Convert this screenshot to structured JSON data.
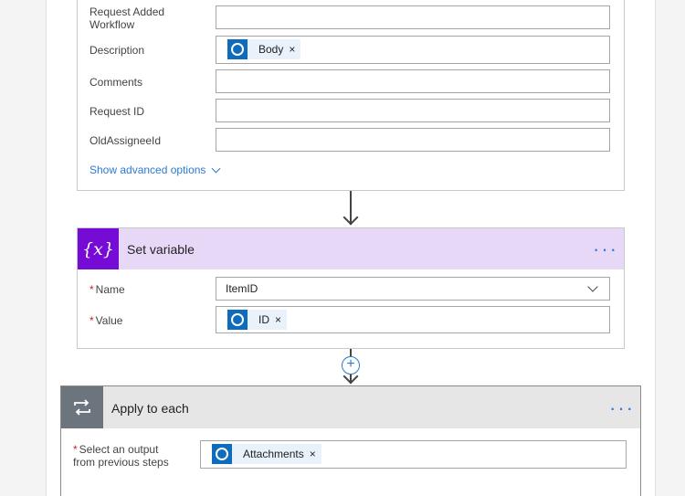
{
  "card1": {
    "fields": [
      {
        "label_line1": "Request Added",
        "label_line2": "Workflow",
        "value": ""
      },
      {
        "label": "Description",
        "token": "Body"
      },
      {
        "label": "Comments",
        "value": ""
      },
      {
        "label": "Request ID",
        "value": ""
      },
      {
        "label": "OldAssigneeId",
        "value": ""
      }
    ],
    "advanced_link": "Show advanced options"
  },
  "set_variable": {
    "icon_text": "{x}",
    "title": "Set variable",
    "menu": "···",
    "name_label": "Name",
    "name_value": "ItemID",
    "value_label": "Value",
    "value_token": "ID"
  },
  "apply_each": {
    "title": "Apply to each",
    "menu": "···",
    "output_label_line1": "Select an output",
    "output_label_line2": "from previous steps",
    "output_token": "Attachments"
  },
  "common": {
    "required_mark": "*",
    "remove_mark": "×",
    "plus_mark": "+"
  },
  "colors": {
    "accent": "#2b7bd1",
    "variable_icon_bg": "#770bd6",
    "variable_header_bg": "#e8d8f8",
    "loop_icon_bg": "#6c757d",
    "outlook_token_icon": "#0f6cbd"
  }
}
